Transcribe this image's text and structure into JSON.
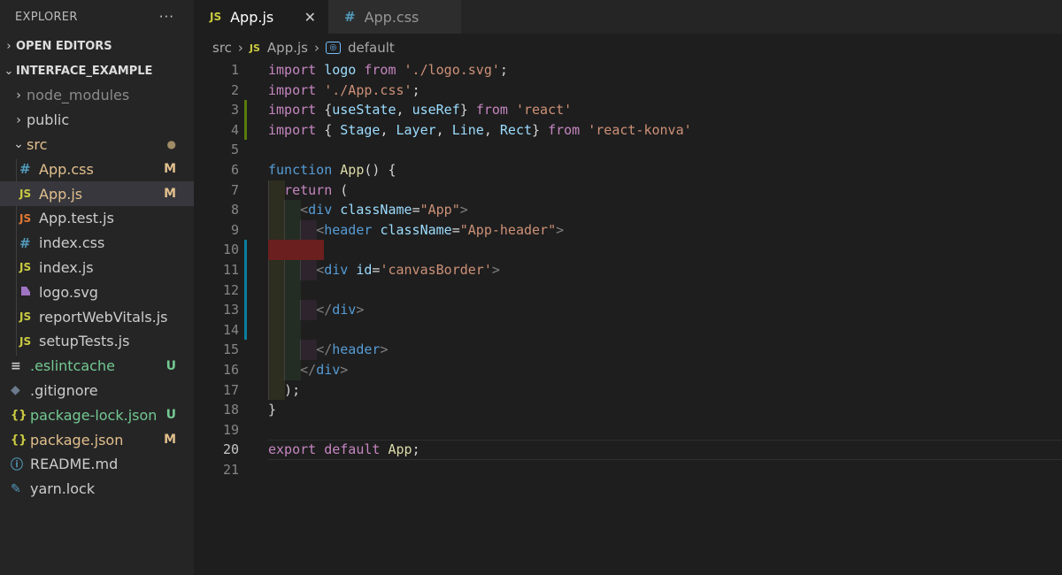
{
  "sidebar": {
    "title": "EXPLORER",
    "more": "···",
    "sections": {
      "open_editors": "OPEN EDITORS",
      "project": "INTERFACE_EXAMPLE"
    },
    "items": [
      {
        "label": "node_modules",
        "badge": ""
      },
      {
        "label": "public",
        "badge": ""
      },
      {
        "label": "src",
        "badge": "●"
      },
      {
        "label": "App.css",
        "badge": "M"
      },
      {
        "label": "App.js",
        "badge": "M"
      },
      {
        "label": "App.test.js",
        "badge": ""
      },
      {
        "label": "index.css",
        "badge": ""
      },
      {
        "label": "index.js",
        "badge": ""
      },
      {
        "label": "logo.svg",
        "badge": ""
      },
      {
        "label": "reportWebVitals.js",
        "badge": ""
      },
      {
        "label": "setupTests.js",
        "badge": ""
      },
      {
        "label": ".eslintcache",
        "badge": "U"
      },
      {
        "label": ".gitignore",
        "badge": ""
      },
      {
        "label": "package-lock.json",
        "badge": "U"
      },
      {
        "label": "package.json",
        "badge": "M"
      },
      {
        "label": "README.md",
        "badge": ""
      },
      {
        "label": "yarn.lock",
        "badge": ""
      }
    ]
  },
  "tabs": [
    {
      "label": "App.js",
      "icon": "JS",
      "close": "✕"
    },
    {
      "label": "App.css",
      "icon": "#"
    }
  ],
  "breadcrumb": {
    "folder": "src",
    "file_icon": "JS",
    "file": "App.js",
    "symbol": "default"
  },
  "editor": {
    "line_numbers": [
      "1",
      "2",
      "3",
      "4",
      "5",
      "6",
      "7",
      "8",
      "9",
      "10",
      "11",
      "12",
      "13",
      "14",
      "15",
      "16",
      "17",
      "18",
      "19",
      "20",
      "21"
    ]
  },
  "colors": {
    "modified": "#e2c08d",
    "untracked": "#73c991",
    "js": "#cbcb41",
    "css": "#519aba",
    "json": "#cbcb41"
  }
}
